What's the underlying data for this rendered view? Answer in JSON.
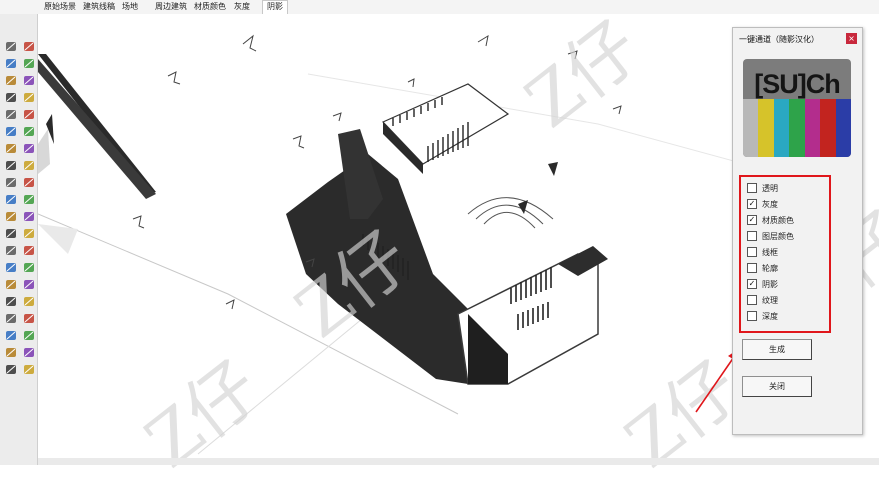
{
  "scene_tabs": [
    {
      "label": "原始场景",
      "active": false
    },
    {
      "label": "建筑线稿",
      "active": false
    },
    {
      "label": "场地",
      "active": false
    },
    {
      "label": "周边建筑",
      "active": false
    },
    {
      "label": "材质颜色",
      "active": false
    },
    {
      "label": "灰度",
      "active": false
    },
    {
      "label": "阴影",
      "active": true
    }
  ],
  "tools": [
    "select-arrow-icon",
    "eraser-icon",
    "paint-bucket-icon",
    "rubber-icon",
    "line-pencil-icon",
    "freehand-icon",
    "rectangle-icon",
    "rotated-rectangle-icon",
    "circle-icon",
    "polygon-icon",
    "arc-icon",
    "two-point-arc-icon",
    "pie-arc-icon",
    "three-point-arc-icon",
    "move-icon",
    "push-pull-icon",
    "rotate-icon",
    "follow-me-icon",
    "scale-icon",
    "offset-icon",
    "tape-measure-icon",
    "dimension-icon",
    "protractor-icon",
    "text-icon",
    "axes-icon",
    "3d-text-icon",
    "orbit-icon",
    "pan-icon",
    "zoom-icon",
    "zoom-window-icon",
    "zoom-extents-icon",
    "previous-view-icon",
    "position-camera-icon",
    "look-around-icon",
    "walk-icon",
    "section-plane-icon",
    "warehouse-icon",
    "extension-warehouse-icon",
    "layout-icon",
    "ruby-icon"
  ],
  "watermark": "Z仔",
  "panel": {
    "title": "一键通道（随影汉化）",
    "close_glyph": "×",
    "logo_text": "[SU]Ch",
    "logo_bar_colors": [
      "#b8b8b8",
      "#d6c32a",
      "#2aa8c2",
      "#2ea34a",
      "#b32d8d",
      "#c2241f",
      "#2b3da7"
    ],
    "options": [
      {
        "label": "透明",
        "checked": false
      },
      {
        "label": "灰度",
        "checked": true
      },
      {
        "label": "材质颜色",
        "checked": true
      },
      {
        "label": "图层颜色",
        "checked": false
      },
      {
        "label": "线框",
        "checked": false
      },
      {
        "label": "轮廓",
        "checked": false
      },
      {
        "label": "阴影",
        "checked": true
      },
      {
        "label": "纹理",
        "checked": false
      },
      {
        "label": "深度",
        "checked": false
      }
    ],
    "generate_label": "生成",
    "close_label": "关闭",
    "highlight_color": "#e0161b"
  }
}
